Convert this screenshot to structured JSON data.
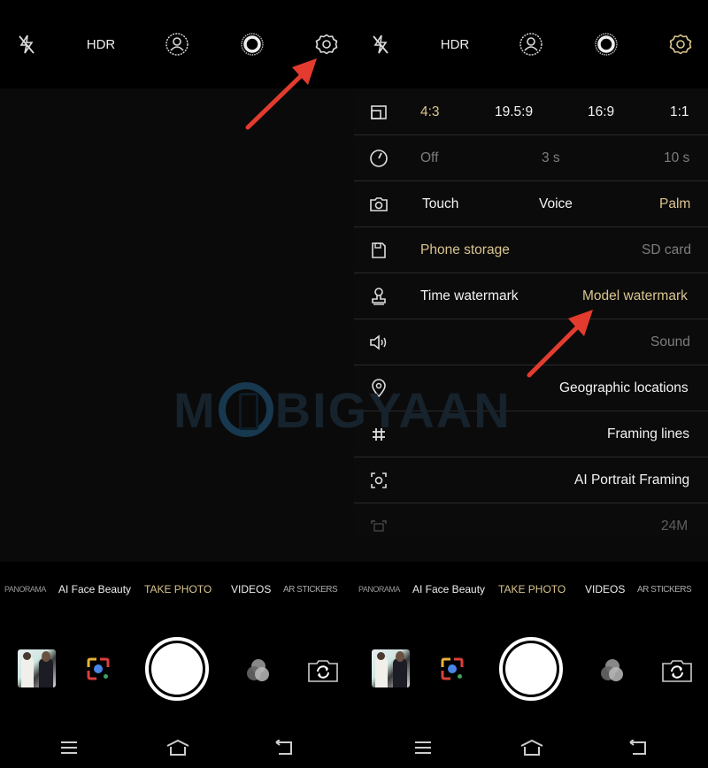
{
  "colors": {
    "accent_gold": "#d9c58f",
    "annotation_arrow": "#e43b2f",
    "background": "#000000",
    "panel_background": "#0c0b0b"
  },
  "top_bar": {
    "flash_icon": "flash-off-icon",
    "hdr_label": "HDR",
    "portrait_icon": "portrait-mode-icon",
    "live_icon": "live-photo-icon",
    "settings_icon": "settings-gear-icon"
  },
  "watermark": {
    "text_left": "M",
    "text_right": "BIGYAAN"
  },
  "settings": {
    "aspect_ratio": {
      "icon": "aspect-ratio-icon",
      "options": [
        "4:3",
        "19.5:9",
        "16:9",
        "1:1"
      ],
      "selected": "4:3"
    },
    "timer": {
      "icon": "timer-icon",
      "options": [
        "Off",
        "3 s",
        "10 s"
      ]
    },
    "capture_method": {
      "icon": "camera-icon",
      "options": [
        "Touch",
        "Voice",
        "Palm"
      ],
      "selected": "Palm"
    },
    "storage": {
      "icon": "storage-icon",
      "options": [
        "Phone storage",
        "SD card"
      ],
      "selected": "Phone storage"
    },
    "watermark": {
      "icon": "stamp-icon",
      "options": [
        "Time watermark",
        "Model watermark"
      ],
      "selected": "Model watermark"
    },
    "sound": {
      "icon": "speaker-icon",
      "label": "Sound"
    },
    "location": {
      "icon": "location-pin-icon",
      "label": "Geographic locations"
    },
    "framing_lines": {
      "icon": "grid-icon",
      "label": "Framing lines"
    },
    "ai_portrait_framing": {
      "icon": "face-frame-icon",
      "label": "AI Portrait Framing"
    },
    "resolution": {
      "icon": "resolution-icon",
      "label": "24M"
    }
  },
  "modes": {
    "items": [
      "PANORAMA",
      "AI Face Beauty",
      "TAKE PHOTO",
      "VIDEOS",
      "AR STICKERS"
    ],
    "selected": "TAKE PHOTO"
  },
  "controls": {
    "gallery_thumbnail": "gallery-thumbnail",
    "lens_icon": "google-lens-icon",
    "shutter": "shutter-button",
    "filter_icon": "filters-icon",
    "switch_icon": "switch-camera-icon"
  },
  "navbar": {
    "menu_icon": "menu-icon",
    "home_icon": "home-icon",
    "back_icon": "back-icon"
  }
}
